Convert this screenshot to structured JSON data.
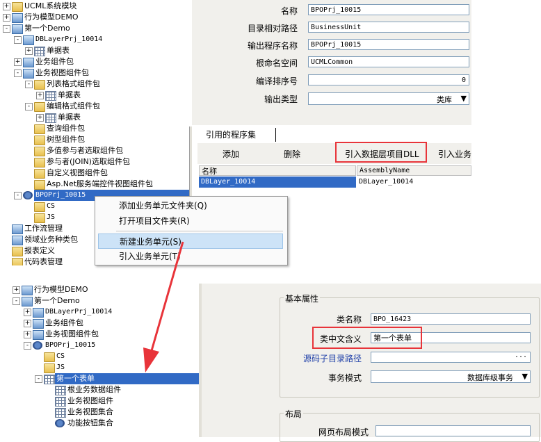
{
  "top_tree": [
    {
      "label": "UCML系统模块",
      "level": 0,
      "exp": "+",
      "icon": "folder"
    },
    {
      "label": "行为模型DEMO",
      "level": 0,
      "exp": "+",
      "icon": "pkg"
    },
    {
      "label": "第一个Demo",
      "level": 0,
      "exp": "-",
      "icon": "pkg"
    },
    {
      "label": "DBLayerPrj_10014",
      "level": 1,
      "exp": "-",
      "icon": "pkg"
    },
    {
      "label": "单据表",
      "level": 2,
      "exp": "+",
      "icon": "grid"
    },
    {
      "label": "业务组件包",
      "level": 1,
      "exp": "+",
      "icon": "pkg"
    },
    {
      "label": "业务视图组件包",
      "level": 1,
      "exp": "-",
      "icon": "pkg"
    },
    {
      "label": "列表格式组件包",
      "level": 2,
      "exp": "-",
      "icon": "folder"
    },
    {
      "label": "单据表",
      "level": 3,
      "exp": "+",
      "icon": "grid"
    },
    {
      "label": "编辑格式组件包",
      "level": 2,
      "exp": "-",
      "icon": "folder"
    },
    {
      "label": "单据表",
      "level": 3,
      "exp": "+",
      "icon": "grid"
    },
    {
      "label": "查询组件包",
      "level": 2,
      "exp": "",
      "icon": "folder"
    },
    {
      "label": "树型组件包",
      "level": 2,
      "exp": "",
      "icon": "folder"
    },
    {
      "label": "多值参与者选取组件包",
      "level": 2,
      "exp": "",
      "icon": "folder"
    },
    {
      "label": "参与者(JOIN)选取组件包",
      "level": 2,
      "exp": "",
      "icon": "folder"
    },
    {
      "label": "自定义视图组件包",
      "level": 2,
      "exp": "",
      "icon": "folder"
    },
    {
      "label": "Asp.Net服务端控件视图组件包",
      "level": 2,
      "exp": "",
      "icon": "folder"
    },
    {
      "label": "BPOPrj_10015",
      "level": 1,
      "exp": "-",
      "icon": "gear",
      "selected": true
    },
    {
      "label": "CS",
      "level": 2,
      "exp": "",
      "icon": "folder"
    },
    {
      "label": "JS",
      "level": 2,
      "exp": "",
      "icon": "folder"
    },
    {
      "label": "工作流管理",
      "level": 0,
      "exp": "",
      "icon": "pkg"
    },
    {
      "label": "领域业务种类包",
      "level": 0,
      "exp": "",
      "icon": "pkg"
    },
    {
      "label": "报表定义",
      "level": 0,
      "exp": "",
      "icon": "folder"
    },
    {
      "label": "代码表管理",
      "level": 0,
      "exp": "",
      "icon": "folder"
    }
  ],
  "top_props": {
    "name_label": "名称",
    "name_value": "BPOPrj_10015",
    "path_label": "目录相对路径",
    "path_value": "BusinessUnit",
    "output_label": "输出程序名称",
    "output_value": "BPOPrj_10015",
    "ns_label": "根命名空间",
    "ns_value": "UCMLCommon",
    "order_label": "编译排序号",
    "order_value": "0",
    "type_label": "输出类型",
    "type_value": "类库"
  },
  "ref_panel": {
    "tab": "引用的程序集",
    "add": "添加",
    "delete": "删除",
    "import_dll": "引入数据层项目DLL",
    "import_biz": "引入业务",
    "col_name": "名称",
    "col_assembly": "AssemblyName",
    "row_name": "DBLayer_10014",
    "row_assembly": "DBLayer_10014"
  },
  "context_menu": [
    "添加业务单元文件夹(Q)",
    "打开项目文件夹(R)",
    "新建业务单元(S)",
    "引入业务单元(T)"
  ],
  "bottom_tree": [
    {
      "label": "行为模型DEMO",
      "level": 0,
      "exp": "+",
      "icon": "pkg"
    },
    {
      "label": "第一个Demo",
      "level": 0,
      "exp": "-",
      "icon": "pkg"
    },
    {
      "label": "DBLayerPrj_10014",
      "level": 1,
      "exp": "+",
      "icon": "pkg"
    },
    {
      "label": "业务组件包",
      "level": 1,
      "exp": "+",
      "icon": "pkg"
    },
    {
      "label": "业务视图组件包",
      "level": 1,
      "exp": "+",
      "icon": "pkg"
    },
    {
      "label": "BPOPrj_10015",
      "level": 1,
      "exp": "-",
      "icon": "gear"
    },
    {
      "label": "CS",
      "level": 2,
      "exp": "",
      "icon": "folder"
    },
    {
      "label": "JS",
      "level": 2,
      "exp": "",
      "icon": "folder"
    },
    {
      "label": "第一个表单",
      "level": 2,
      "exp": "-",
      "icon": "grid",
      "selected": true
    },
    {
      "label": "根业务数据组件",
      "level": 3,
      "exp": "",
      "icon": "grid"
    },
    {
      "label": "业务视图组件",
      "level": 3,
      "exp": "",
      "icon": "grid"
    },
    {
      "label": "业务视图集合",
      "level": 3,
      "exp": "",
      "icon": "grid"
    },
    {
      "label": "功能按钮集合",
      "level": 3,
      "exp": "",
      "icon": "gear"
    }
  ],
  "bottom_props": {
    "group_basic": "基本属性",
    "class_label": "类名称",
    "class_value": "BPO_16423",
    "cn_label": "类中文含义",
    "cn_value": "第一个表单",
    "src_label": "源码子目录路径",
    "src_btn": "···",
    "tx_label": "事务模式",
    "tx_value": "数据库级事务",
    "group_layout": "布局",
    "layout_label": "网页布局模式"
  }
}
